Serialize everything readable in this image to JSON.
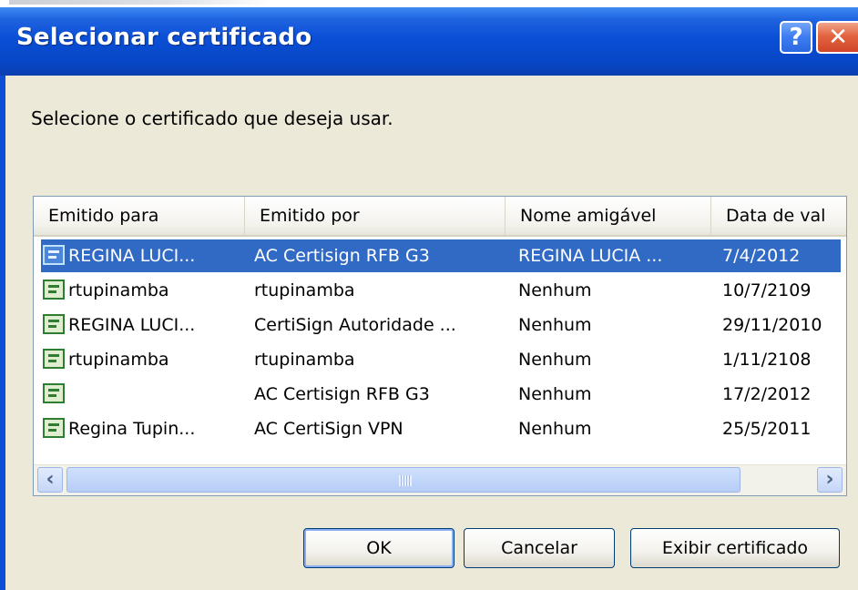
{
  "window": {
    "title": "Selecionar certificado",
    "help_button": "?",
    "close_button": "✕"
  },
  "prompt": "Selecione o certificado que deseja usar.",
  "table": {
    "headers": [
      "Emitido para",
      "Emitido por",
      "Nome amigável",
      "Data de val"
    ],
    "rows": [
      {
        "issued_to": "REGINA LUCI...",
        "issued_by": "AC Certisign RFB G3",
        "friendly_name": "REGINA LUCIA ...",
        "valid_date": "7/4/2012"
      },
      {
        "issued_to": "rtupinamba",
        "issued_by": "rtupinamba",
        "friendly_name": "Nenhum",
        "valid_date": "10/7/2109"
      },
      {
        "issued_to": "REGINA LUCI...",
        "issued_by": "CertiSign Autoridade ...",
        "friendly_name": "Nenhum",
        "valid_date": "29/11/2010"
      },
      {
        "issued_to": "rtupinamba",
        "issued_by": "rtupinamba",
        "friendly_name": "Nenhum",
        "valid_date": "1/11/2108"
      },
      {
        "issued_to": "",
        "issued_by": "AC Certisign RFB G3",
        "friendly_name": "Nenhum",
        "valid_date": "17/2/2012"
      },
      {
        "issued_to": "Regina Tupin...",
        "issued_by": "AC CertiSign VPN",
        "friendly_name": "Nenhum",
        "valid_date": "25/5/2011"
      }
    ],
    "selected_row": 0
  },
  "scrollbar": {
    "left_arrow": "‹",
    "right_arrow": "›"
  },
  "buttons": {
    "ok": "OK",
    "cancel": "Cancelar",
    "view": "Exibir certificado"
  },
  "colors": {
    "titlebar": "#0a4fd6",
    "selection": "#316ac5",
    "dialog_bg": "#ece9d8"
  }
}
